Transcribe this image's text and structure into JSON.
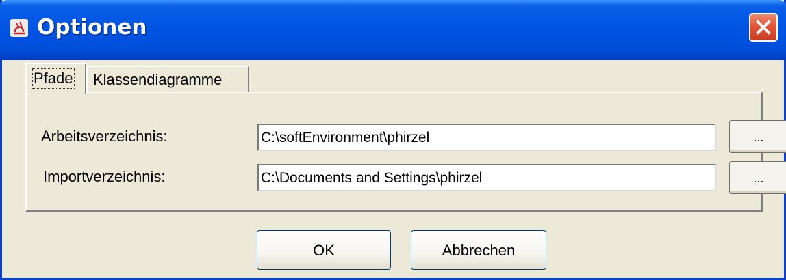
{
  "window": {
    "title": "Optionen",
    "app_icon": "java-app-icon",
    "close_icon": "close-icon",
    "close_color": "#d5492f",
    "accent": "#0054e3"
  },
  "tabs": [
    {
      "label": "Pfade",
      "active": true
    },
    {
      "label": "Klassendiagramme",
      "active": false
    }
  ],
  "paths": {
    "work_label": "Arbeitsverzeichnis:",
    "work_value": "C:\\softEnvironment\\phirzel",
    "work_browse": "...",
    "import_label": "Importverzeichnis:",
    "import_value": "C:\\Documents and Settings\\phirzel",
    "import_browse": "..."
  },
  "buttons": {
    "ok": "OK",
    "cancel": "Abbrechen"
  }
}
